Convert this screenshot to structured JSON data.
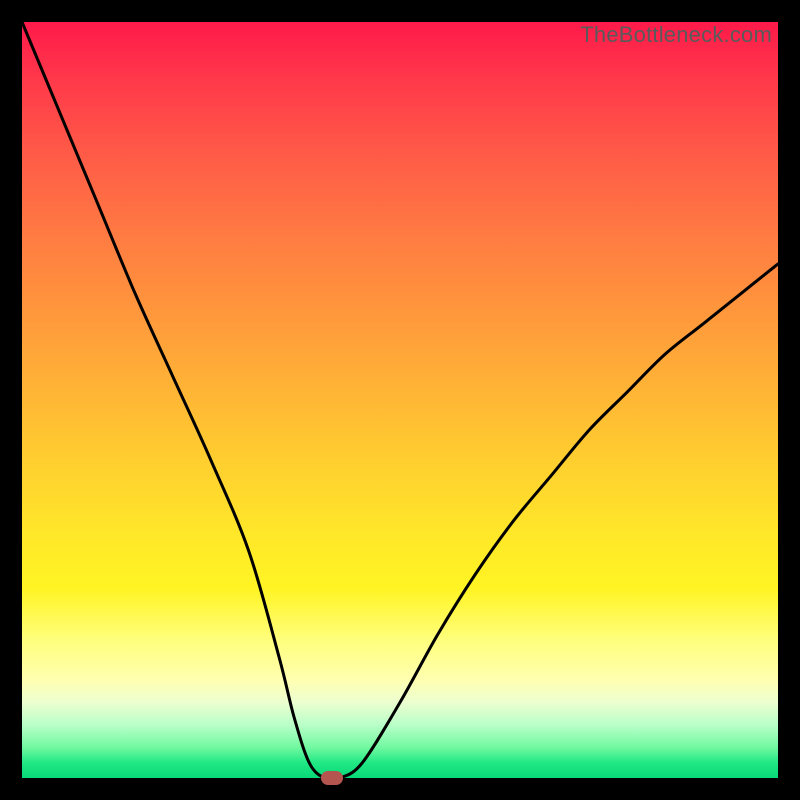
{
  "watermark": "TheBottleneck.com",
  "chart_data": {
    "type": "line",
    "title": "",
    "xlabel": "",
    "ylabel": "",
    "xlim": [
      0,
      100
    ],
    "ylim": [
      0,
      100
    ],
    "grid": false,
    "legend": false,
    "background_gradient": {
      "top": "#ff1a4a",
      "middle": "#ffe228",
      "bottom": "#08d878"
    },
    "series": [
      {
        "name": "bottleneck-curve",
        "color": "#000000",
        "x": [
          0,
          5,
          10,
          15,
          20,
          25,
          30,
          34,
          36,
          38,
          40,
          42,
          45,
          50,
          55,
          60,
          65,
          70,
          75,
          80,
          85,
          90,
          95,
          100
        ],
        "values": [
          100,
          88,
          76,
          64,
          53,
          42,
          30,
          16,
          8,
          2,
          0,
          0,
          2,
          10,
          19,
          27,
          34,
          40,
          46,
          51,
          56,
          60,
          64,
          68
        ]
      }
    ],
    "optimal_marker": {
      "x": 41,
      "y": 0,
      "color": "#b5554f"
    }
  }
}
